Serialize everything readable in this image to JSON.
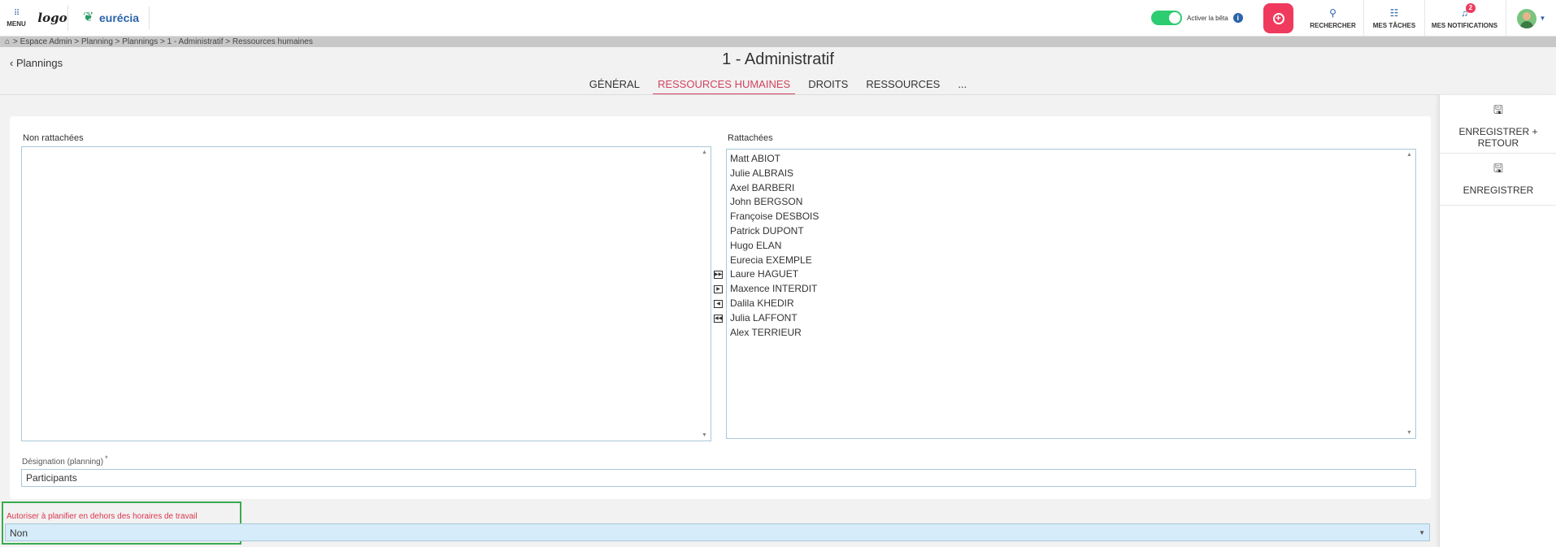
{
  "topbar": {
    "menu_label": "MENU",
    "logo_text": "logo",
    "brand_name": "eurécia",
    "beta_label": "Activer la bêta",
    "search_label": "RECHERCHER",
    "tasks_label": "MES TÂCHES",
    "notifications_label": "MES NOTIFICATIONS",
    "notifications_count": "2"
  },
  "breadcrumb": {
    "text": "> Espace Admin > Planning > Plannings > 1 - Administratif > Ressources humaines"
  },
  "page": {
    "back_label": "Plannings",
    "title": "1 - Administratif"
  },
  "tabs": [
    {
      "label": "GÉNÉRAL"
    },
    {
      "label": "RESSOURCES HUMAINES"
    },
    {
      "label": "DROITS"
    },
    {
      "label": "RESSOURCES"
    },
    {
      "label": "..."
    }
  ],
  "lists": {
    "unattached_label": "Non rattachées",
    "attached_label": "Rattachées",
    "attached_items": [
      "Matt ABIOT",
      "Julie ALBRAIS",
      "Axel BARBERI",
      "John BERGSON",
      "Françoise DESBOIS",
      "Patrick DUPONT",
      "Hugo ELAN",
      "Eurecia EXEMPLE",
      "Laure HAGUET",
      "Maxence INTERDIT",
      "Dalila KHEDIR",
      "Julia LAFFONT",
      "Alex TERRIEUR"
    ]
  },
  "designation": {
    "label": "Désignation (planning)",
    "required_mark": "*",
    "value": "Participants"
  },
  "outside_hours": {
    "label": "Autoriser à planifier en dehors des horaires de travail",
    "value": "Non"
  },
  "side_actions": {
    "save_return": "ENREGISTRER + RETOUR",
    "save": "ENREGISTRER"
  },
  "colors": {
    "accent": "#ef3a5d",
    "brand_blue": "#2a63a8",
    "active_tab": "#d1445e",
    "highlight_border": "#3aab4f"
  }
}
